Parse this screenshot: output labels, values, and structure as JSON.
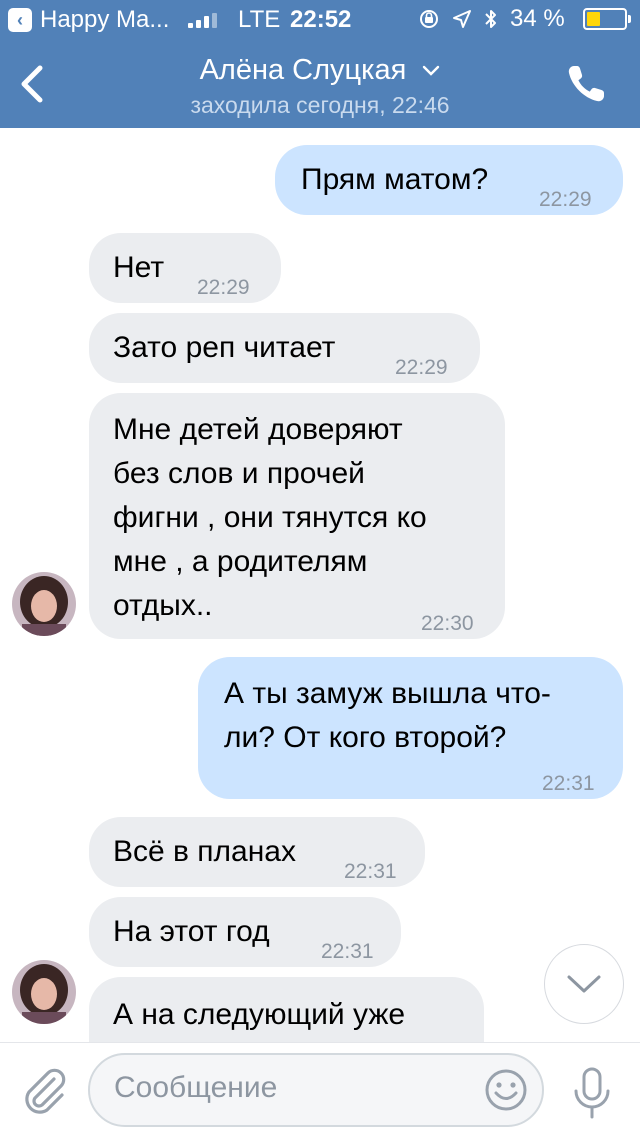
{
  "status_bar": {
    "carrier": "Happy Ma...",
    "network": "LTE",
    "time": "22:52",
    "battery": "34 %",
    "battery_level": 0.34
  },
  "header": {
    "contact_name": "Алёна Слуцкая",
    "last_seen": "заходила сегодня, 22:46"
  },
  "messages": [
    {
      "dir": "out",
      "text": "Прям матом?",
      "time": "22:29"
    },
    {
      "dir": "in",
      "text": "Нет",
      "time": "22:29"
    },
    {
      "dir": "in",
      "text": "Зато реп читает",
      "time": "22:29"
    },
    {
      "dir": "in",
      "lines": [
        "Мне детей доверяют",
        "без слов и прочей",
        "фигни , они тянутся ко",
        "мне , а родителям",
        "отдых.."
      ],
      "time": "22:30"
    },
    {
      "dir": "out",
      "lines": [
        "А ты замуж вышла что-",
        "ли? От кого второй?"
      ],
      "time": "22:31"
    },
    {
      "dir": "in",
      "text": "Всё в планах",
      "time": "22:31"
    },
    {
      "dir": "in",
      "text": "На этот год",
      "time": "22:31"
    },
    {
      "dir": "in",
      "text": "А на следующий уже",
      "time": ""
    }
  ],
  "composer": {
    "placeholder": "Сообщение"
  },
  "colors": {
    "header_bg": "#5181b8",
    "incoming_bubble": "#ebedf0",
    "outgoing_bubble": "#cce4ff"
  }
}
